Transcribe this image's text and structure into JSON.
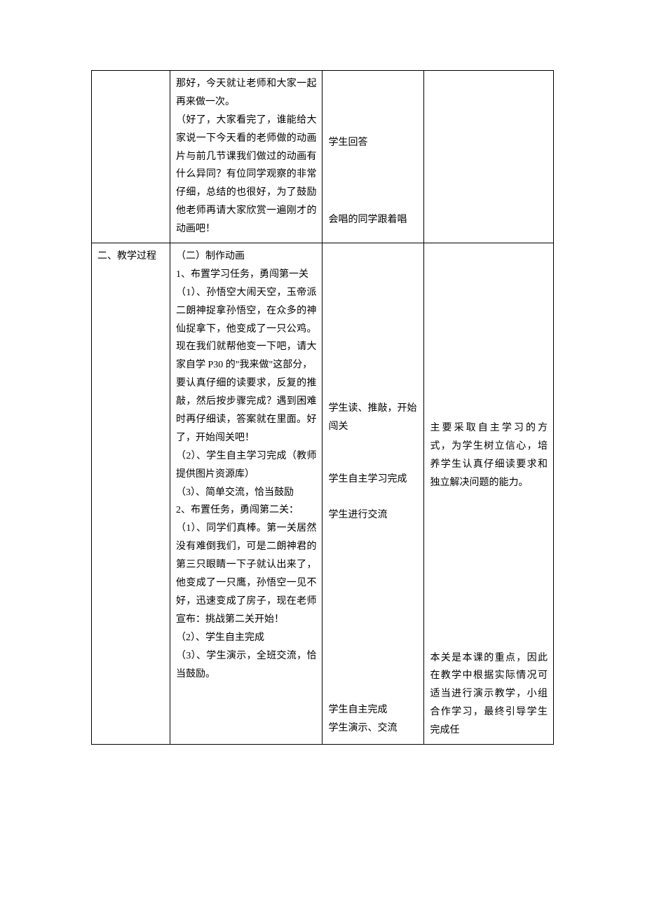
{
  "row1": {
    "col1": "",
    "col2_p1": "那好，今天就让老师和大家一起再来做一次。",
    "col2_p2": "（好了，大家看完了，谁能给大家说一下今天看的老师做的动画片与前几节课我们做过的动画有什么异同？有位同学观察的非常仔细，总结的也很好，为了鼓励他老师再请大家欣赏一遍刚才的动画吧！",
    "col3_p1": "学生回答",
    "col3_p2": "会唱的同学跟着唱",
    "col4": ""
  },
  "row2": {
    "col1": "二、教学过程",
    "col2_s1_title": "（二）制作动画",
    "col2_s1_1": "1、布置学习任务，勇闯第一关",
    "col2_s1_1_1": "（1）、孙悟空大闹天空，玉帝派二朗神捉拿孙悟空，在众多的神仙捉拿下，他变成了一只公鸡。现在我们就帮他变一下吧，请大家自学 P30 的\"我来做\"这部分，",
    "col2_s1_1_req": "要认真仔细的读要求，反复的推敲，然后按步骤完成？遇到困难时再仔细读，答案就在里面。好了，开始闯关吧！",
    "col2_s1_1_2": "（2）、学生自主学习完成（教师提供图片资源库）",
    "col2_s1_1_3": "（3）、简单交流，恰当鼓励",
    "col2_s1_2": "2、布置任务，勇闯第二关：",
    "col2_s1_2_1": "（1）、同学们真棒。第一关居然没有难倒我们，可是二朗神君的第三只眼睛一下子就认出来了，他变成了一只鹰，孙悟空一见不好，迅速变成了房子，现在老师宣布：挑战第二关开始！",
    "col2_s1_2_2": "（2）、学生自主完成",
    "col2_s1_2_3": "（3）、学生演示，全班交流，恰当鼓励。",
    "col3_p1": "学生读、推敲，开始闯关",
    "col3_p2": "学生自主学习完成",
    "col3_p3": "学生进行交流",
    "col3_p4": "学生自主完成",
    "col3_p5": "学生演示、交流",
    "col4_p1": "主要采取自主学习的方式，为学生树立信心，培养学生认真仔细读要求和独立解决问题的能力。",
    "col4_p2": "本关是本课的重点，因此在教学中根据实际情况可适当进行演示教学，小组合作学习，最终引导学生完成任"
  }
}
